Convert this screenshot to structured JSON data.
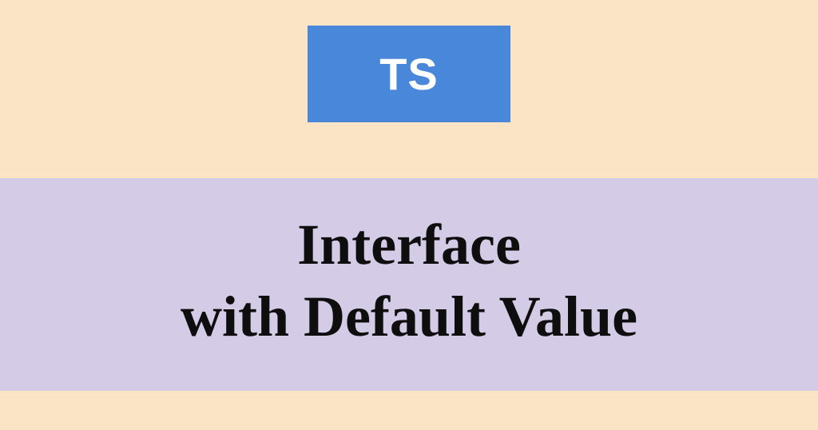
{
  "badge": {
    "label": "TS"
  },
  "title": {
    "line1": "Interface",
    "line2": "with Default Value"
  }
}
